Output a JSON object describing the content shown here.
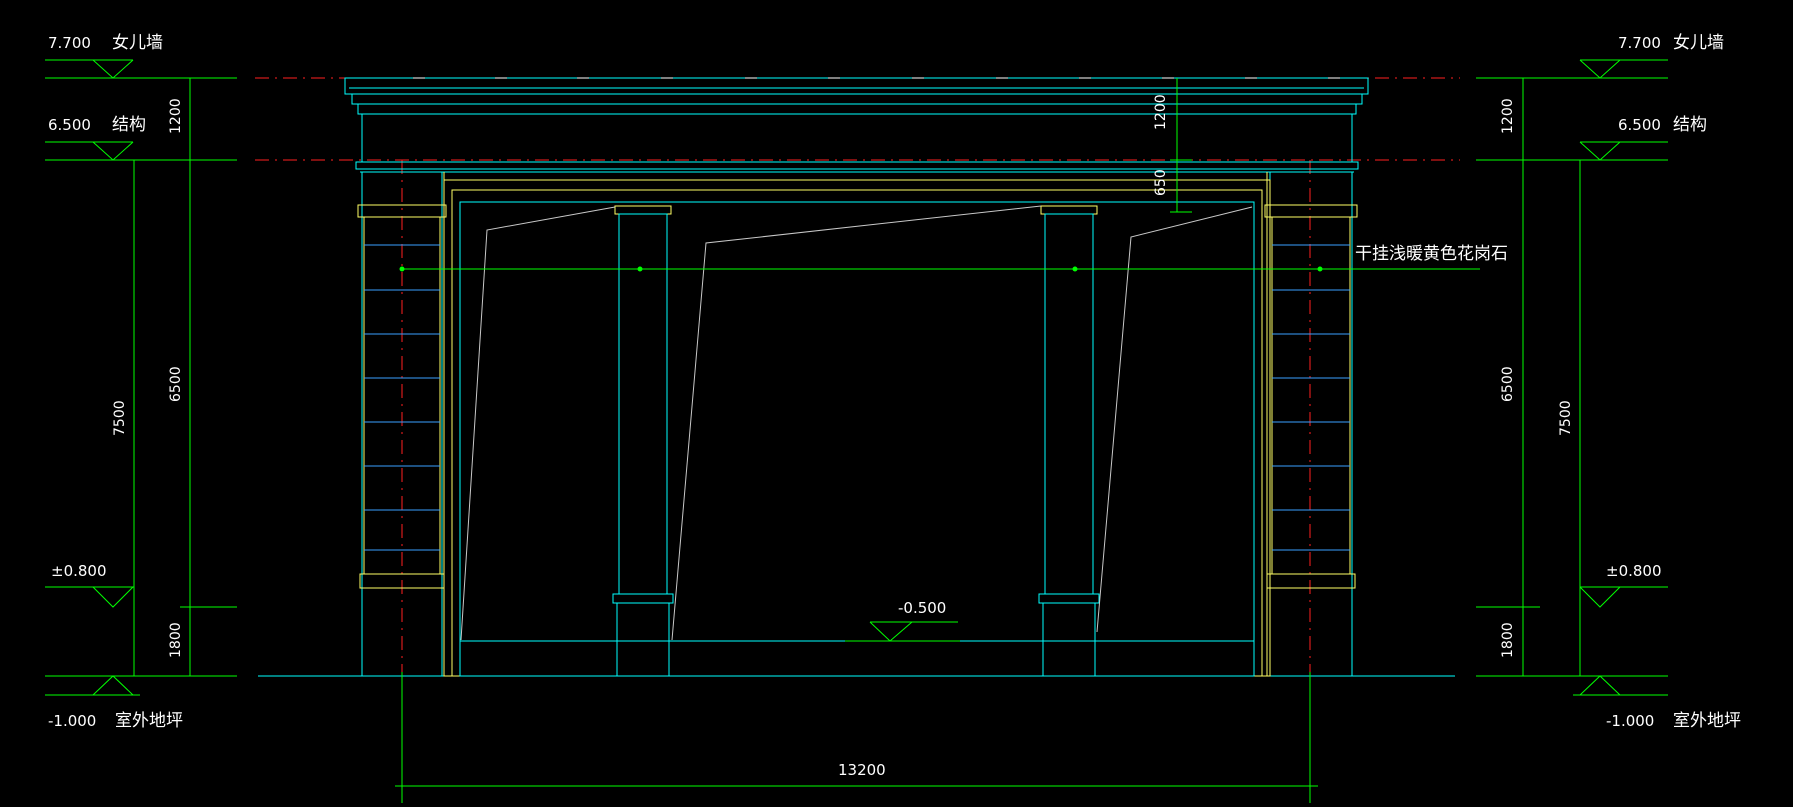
{
  "levels": {
    "parapet": {
      "value": "7.700",
      "label": "女儿墙"
    },
    "structure": {
      "value": "6.500",
      "label": "结构"
    },
    "ground": {
      "value": "±0.800",
      "label": ""
    },
    "outdoor": {
      "value": "-1.000",
      "label": "室外地坪"
    },
    "inner_floor": {
      "value": "-0.500"
    }
  },
  "dimensions": {
    "top": "1200",
    "mid": "6500",
    "total": "7500",
    "bottom": "1800",
    "bottom_right": "1800",
    "lintel_top": "1200",
    "lintel_band": "650",
    "width": "13200"
  },
  "annotation": {
    "material": "干挂浅暖黄色花岗石"
  },
  "colors": {
    "background": "#000000",
    "dimension": "#00ff00",
    "outline": "#00ffff",
    "frame": "#ffff66",
    "text": "#ffffff",
    "centerline": "#ff0000",
    "tile": "#3aa0ff",
    "sketch": "#c8c8c8"
  }
}
